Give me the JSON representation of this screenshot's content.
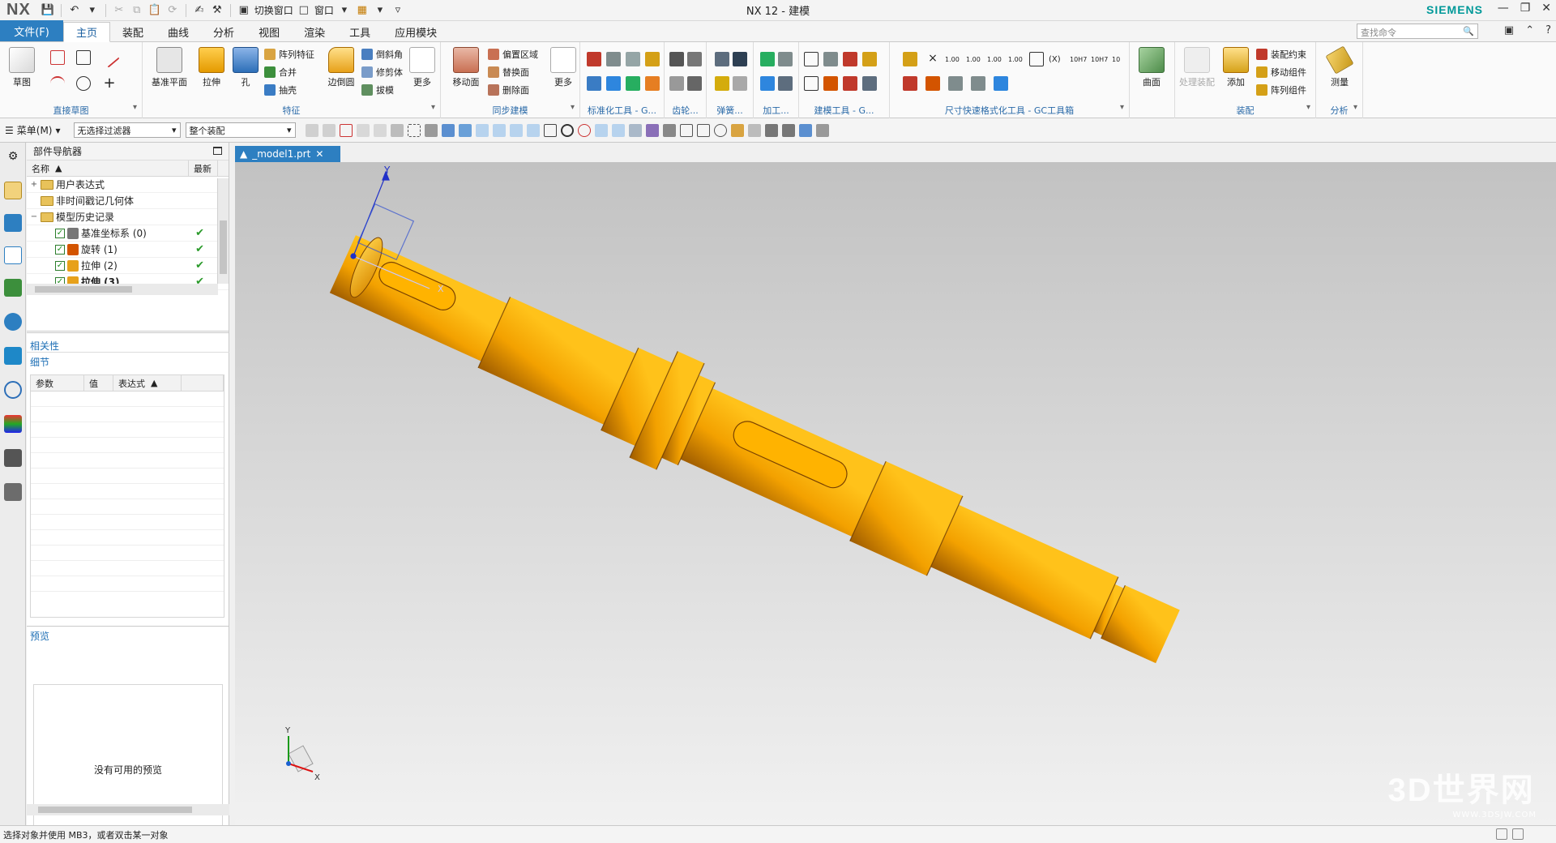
{
  "app": {
    "logo": "NX",
    "title": "NX 12 - 建模",
    "brand": "SIEMENS",
    "quick_switch_window": "切换窗口",
    "quick_window": "窗口"
  },
  "tabs": {
    "file": "文件(F)",
    "items": [
      "主页",
      "装配",
      "曲线",
      "分析",
      "视图",
      "渲染",
      "工具",
      "应用模块"
    ],
    "active": "主页",
    "search_placeholder": "查找命令"
  },
  "ribbon": {
    "direct_sketch": {
      "label": "直接草图",
      "sketch": "草图"
    },
    "feature": {
      "label": "特征",
      "datum_plane": "基准平面",
      "extrude": "拉伸",
      "hole": "孔",
      "pattern_feature": "阵列特征",
      "unite": "合并",
      "shell": "抽壳",
      "edge_blend": "边倒圆",
      "chamfer": "倒斜角",
      "trim_body": "修剪体",
      "draft": "拔模",
      "more": "更多"
    },
    "sync_modeling": {
      "label": "同步建模",
      "move_face": "移动面",
      "offset_region": "偏置区域",
      "replace_face": "替换面",
      "delete_face": "删除面",
      "more": "更多"
    },
    "std_tools": "标准化工具 - G...",
    "gear": "齿轮...",
    "spring": "弹簧...",
    "machining": "加工...",
    "modeling_tools": "建模工具 - G...",
    "dimension_tools": "尺寸快速格式化工具 - GC工具箱",
    "surface": {
      "label": "曲面"
    },
    "assembly": {
      "label": "装配",
      "wave_assembly": "处理装配",
      "add": "添加",
      "constraint": "装配约束",
      "move_component": "移动组件",
      "pattern_component": "阵列组件"
    },
    "analysis": {
      "label": "分析",
      "measure": "测量"
    },
    "dim_labels": [
      "1.00",
      "1.00",
      "1.00",
      "1.00",
      "10H7",
      "10H7",
      "10"
    ]
  },
  "toolbar2": {
    "menu": "菜单(M)",
    "filter": "无选择过滤器",
    "scope": "整个装配"
  },
  "navigator": {
    "title": "部件导航器",
    "col_name": "名称",
    "col_latest": "最新",
    "rows": [
      {
        "label": "用户表达式",
        "level": 0,
        "kind": "folder",
        "expander": "+"
      },
      {
        "label": "非时间戳记几何体",
        "level": 0,
        "kind": "folder",
        "expander": ""
      },
      {
        "label": "模型历史记录",
        "level": 0,
        "kind": "folder",
        "expander": "−"
      },
      {
        "label": "基准坐标系 (0)",
        "level": 1,
        "kind": "datum",
        "ok": "✔"
      },
      {
        "label": "旋转 (1)",
        "level": 1,
        "kind": "revolve",
        "ok": "✔"
      },
      {
        "label": "拉伸 (2)",
        "level": 1,
        "kind": "extrude",
        "ok": "✔"
      },
      {
        "label": "拉伸 (3)",
        "level": 1,
        "kind": "extrude",
        "ok": "✔",
        "bold": true
      }
    ],
    "dependency": "相关性",
    "details": "细节",
    "details_cols": [
      "参数",
      "值",
      "表达式"
    ],
    "preview": "预览",
    "no_preview": "没有可用的预览"
  },
  "graphics": {
    "tab": "_model1.prt",
    "triad_x": "X",
    "triad_y": "Y",
    "csys_x": "X",
    "csys_y": "Y"
  },
  "status": {
    "message": "选择对象并使用 MB3，或者双击某一对象"
  },
  "watermark": {
    "text": "3D世界网",
    "url": "WWW.3DSJW.COM"
  },
  "colors": {
    "accent": "#2d7fc1",
    "shaft_light": "#ffb000",
    "shaft_dark": "#a85f00",
    "brand": "#009999"
  }
}
